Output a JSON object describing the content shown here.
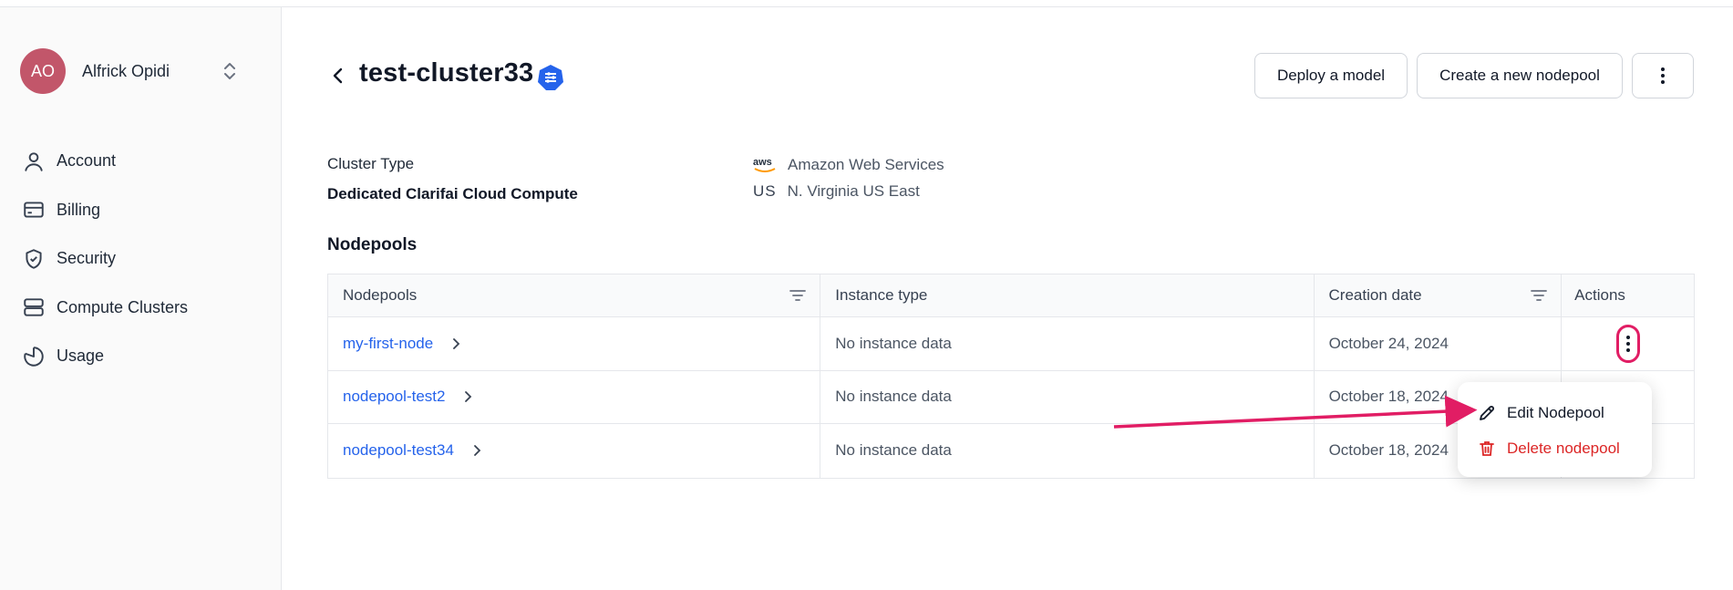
{
  "user": {
    "initials": "AO",
    "name": "Alfrick Opidi"
  },
  "sidebar": {
    "items": [
      {
        "label": "Account",
        "icon": "user-icon"
      },
      {
        "label": "Billing",
        "icon": "credit-card-icon"
      },
      {
        "label": "Security",
        "icon": "shield-icon"
      },
      {
        "label": "Compute Clusters",
        "icon": "server-icon"
      },
      {
        "label": "Usage",
        "icon": "pie-chart-icon"
      }
    ]
  },
  "header": {
    "title": "test-cluster33",
    "deploy_label": "Deploy a model",
    "create_label": "Create a new nodepool"
  },
  "cluster": {
    "type_label": "Cluster Type",
    "type_value": "Dedicated Clarifai Cloud Compute",
    "provider_logo": "aws",
    "provider": "Amazon Web Services",
    "region_code": "US",
    "region": "N. Virginia US East"
  },
  "nodepools": {
    "section_title": "Nodepools",
    "columns": [
      "Nodepools",
      "Instance type",
      "Creation date",
      "Actions"
    ],
    "rows": [
      {
        "name": "my-first-node",
        "instance": "No instance data",
        "date": "October 24, 2024"
      },
      {
        "name": "nodepool-test2",
        "instance": "No instance data",
        "date": "October 18, 2024"
      },
      {
        "name": "nodepool-test34",
        "instance": "No instance data",
        "date": "October 18, 2024"
      }
    ]
  },
  "menu": {
    "edit_label": "Edit Nodepool",
    "delete_label": "Delete nodepool"
  },
  "colors": {
    "accent": "#2563eb",
    "danger": "#dc2626",
    "annotation": "#e11d64",
    "avatar": "#c2566a"
  }
}
